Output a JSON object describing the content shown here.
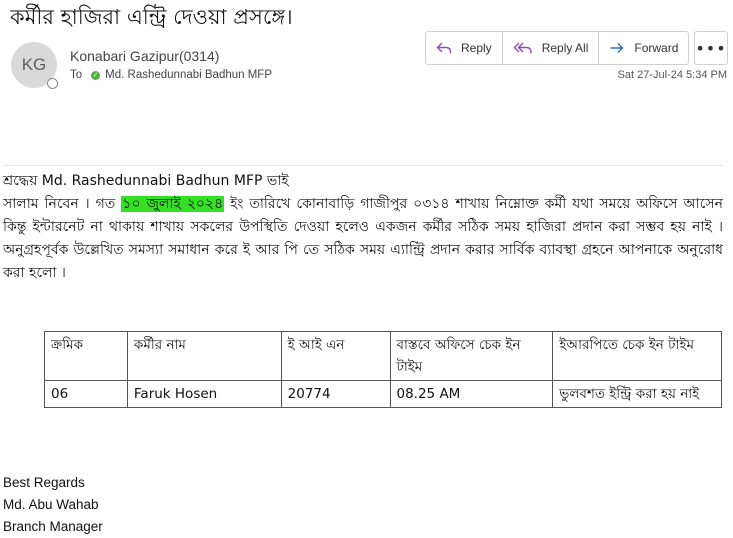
{
  "email": {
    "subject": "কর্মীর হাজিরা এন্ট্রি দেওয়া প্রসঙ্গে।",
    "avatar_initials": "KG",
    "sender": "Konabari Gazipur(0314)",
    "to_label": "To",
    "recipient": "Md. Rashedunnabi Badhun MFP",
    "date": "Sat 27-Jul-24 5:34 PM"
  },
  "toolbar": {
    "reply": "Reply",
    "reply_all": "Reply All",
    "forward": "Forward",
    "more": "•••"
  },
  "body": {
    "greeting": "শ্রদ্ধেয় Md. Rashedunnabi Badhun MFP ভাই",
    "para_before": "সালাম নিবেন । গত ",
    "para_highlight": "১০ জুলাই ২০২৪",
    "para_after": " ইং তারিখে কোনাবাড়ি গাজীপুর ০৩১৪ শাখায় নিম্নোক্ত কর্মী যথা সময়ে অফিসে আসেন কিন্তু ইন্টারনেট না থাকায় শাখায় সকলের উপস্থিতি দেওয়া হলেও একজন কর্মীর সঠিক সময়  হাজিরা প্রদান করা সম্ভব হয় নাই । অনুগ্রহপূর্বক উল্লেখিত সমস্যা সমাধান করে ই আর পি তে সঠিক সময় এ্যান্ট্রি প্রদান করার সার্বিক ব্যাবস্থা গ্রহনে আপনাকে অনুরোধ করা হলো ।"
  },
  "table": {
    "headers": [
      "ক্রমিক",
      "কর্মীর নাম",
      "ই আই এন",
      "বাস্তবে অফিসে চেক ইন টাইম",
      "ইআরপিতে চেক ইন টাইম"
    ],
    "rows": [
      [
        "06",
        "Faruk Hosen",
        "20774",
        "08.25 AM",
        "ভুলবশত ইন্ট্রি করা হয় নাই"
      ]
    ]
  },
  "signature": {
    "regards": "Best Regards",
    "name": "Md. Abu Wahab",
    "title": "Branch Manager"
  }
}
